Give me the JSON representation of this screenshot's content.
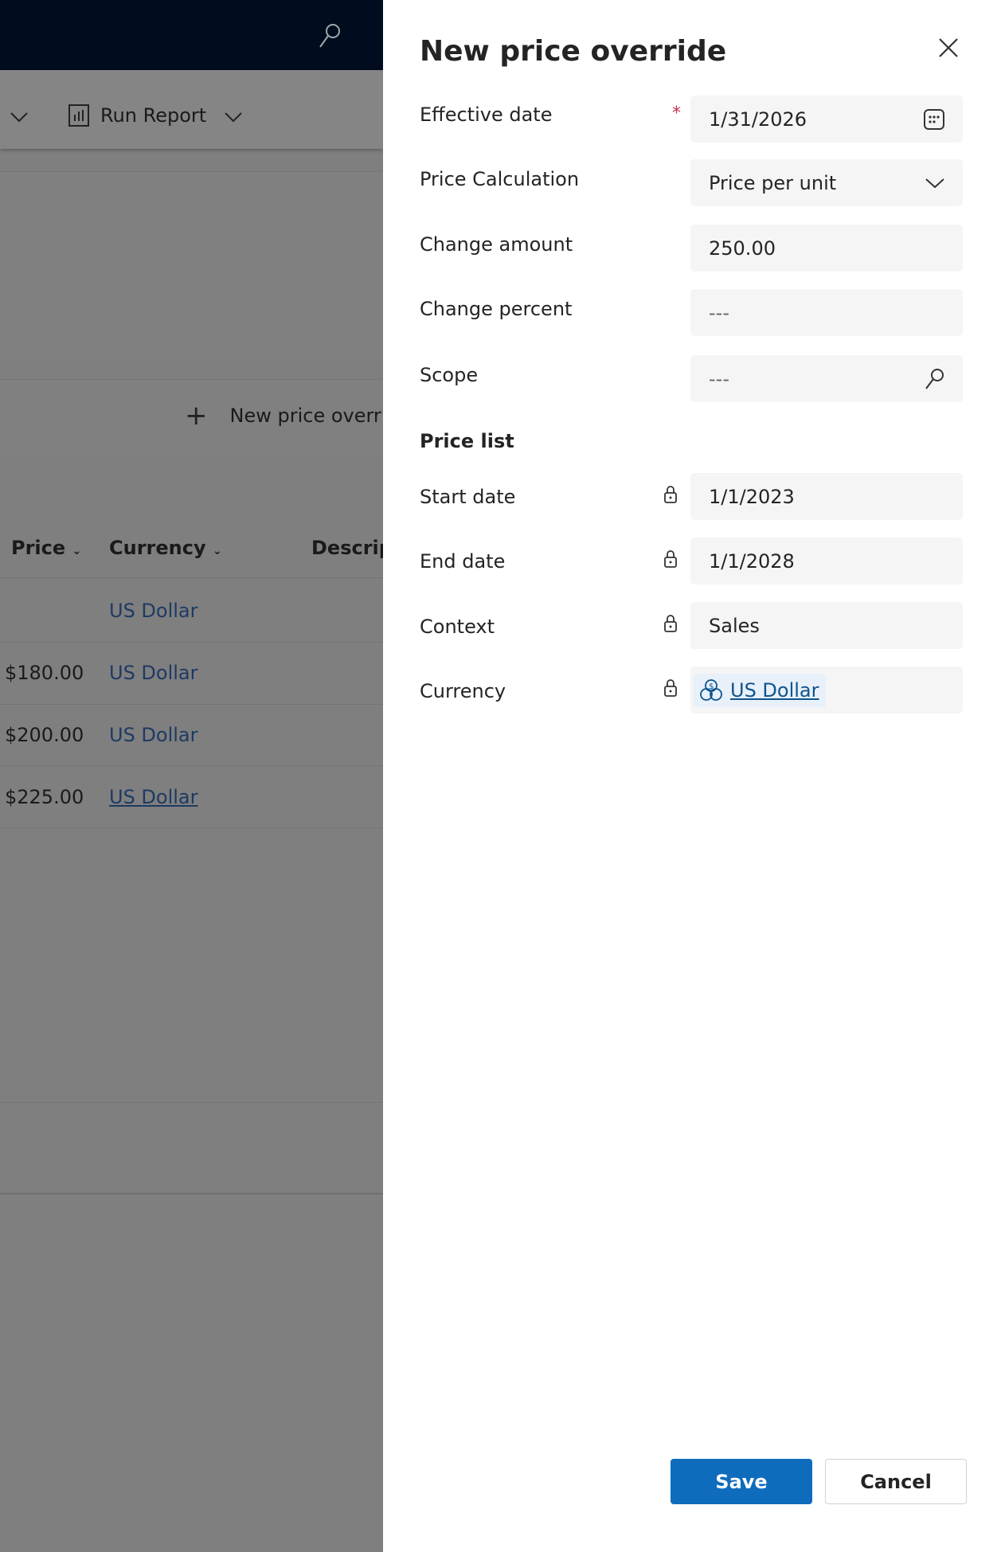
{
  "background": {
    "toolbar": {
      "run_report_label": "Run Report"
    },
    "subgrid": {
      "new_button_label": "New price overri"
    },
    "columns": [
      "Price",
      "Currency",
      "Descrip"
    ],
    "rows": [
      {
        "price": "",
        "currency": "US Dollar"
      },
      {
        "price": "$180.00",
        "currency": "US Dollar"
      },
      {
        "price": "$200.00",
        "currency": "US Dollar"
      },
      {
        "price": "$225.00",
        "currency": "US Dollar"
      }
    ]
  },
  "panel": {
    "title": "New price override",
    "fields": {
      "effective_date": {
        "label": "Effective date",
        "value": "1/31/2026",
        "required_mark": "*"
      },
      "price_calculation": {
        "label": "Price Calculation",
        "value": "Price per unit"
      },
      "change_amount": {
        "label": "Change amount",
        "value": "250.00"
      },
      "change_percent": {
        "label": "Change percent",
        "value": "---"
      },
      "scope": {
        "label": "Scope",
        "value": "---"
      }
    },
    "section_title": "Price list",
    "locked_fields": {
      "start_date": {
        "label": "Start date",
        "value": "1/1/2023"
      },
      "end_date": {
        "label": "End date",
        "value": "1/1/2028"
      },
      "context": {
        "label": "Context",
        "value": "Sales"
      },
      "currency": {
        "label": "Currency",
        "value": "US Dollar"
      }
    },
    "save_label": "Save",
    "cancel_label": "Cancel",
    "accent_color": "#0f6cbd"
  }
}
